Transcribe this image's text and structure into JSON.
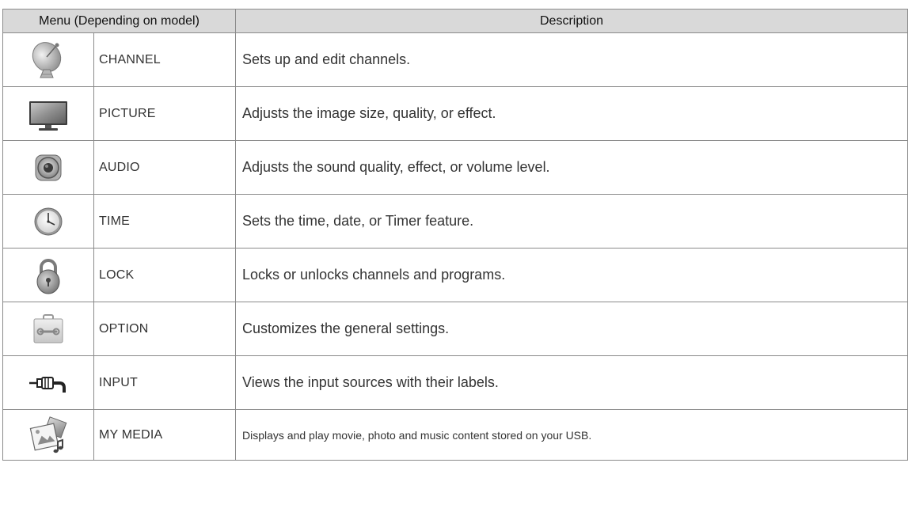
{
  "header": {
    "menu_col": "Menu (Depending on model)",
    "desc_col": "Description"
  },
  "rows": [
    {
      "icon": "satellite-dish-icon",
      "name": "CHANNEL",
      "description": "Sets up and edit channels."
    },
    {
      "icon": "tv-monitor-icon",
      "name": "PICTURE",
      "description": "Adjusts the image size, quality, or effect."
    },
    {
      "icon": "speaker-icon",
      "name": "AUDIO",
      "description": "Adjusts the sound quality, effect, or volume level."
    },
    {
      "icon": "clock-icon",
      "name": "TIME",
      "description": "Sets the time, date, or Timer feature."
    },
    {
      "icon": "padlock-icon",
      "name": "LOCK",
      "description": "Locks or unlocks channels and programs."
    },
    {
      "icon": "toolbox-icon",
      "name": "OPTION",
      "description": "Customizes the general settings."
    },
    {
      "icon": "input-cable-icon",
      "name": "INPUT",
      "description": "Views the input sources with their labels."
    },
    {
      "icon": "media-icon",
      "name": "MY MEDIA",
      "description": "Displays and play movie, photo and music content stored on your USB."
    }
  ]
}
